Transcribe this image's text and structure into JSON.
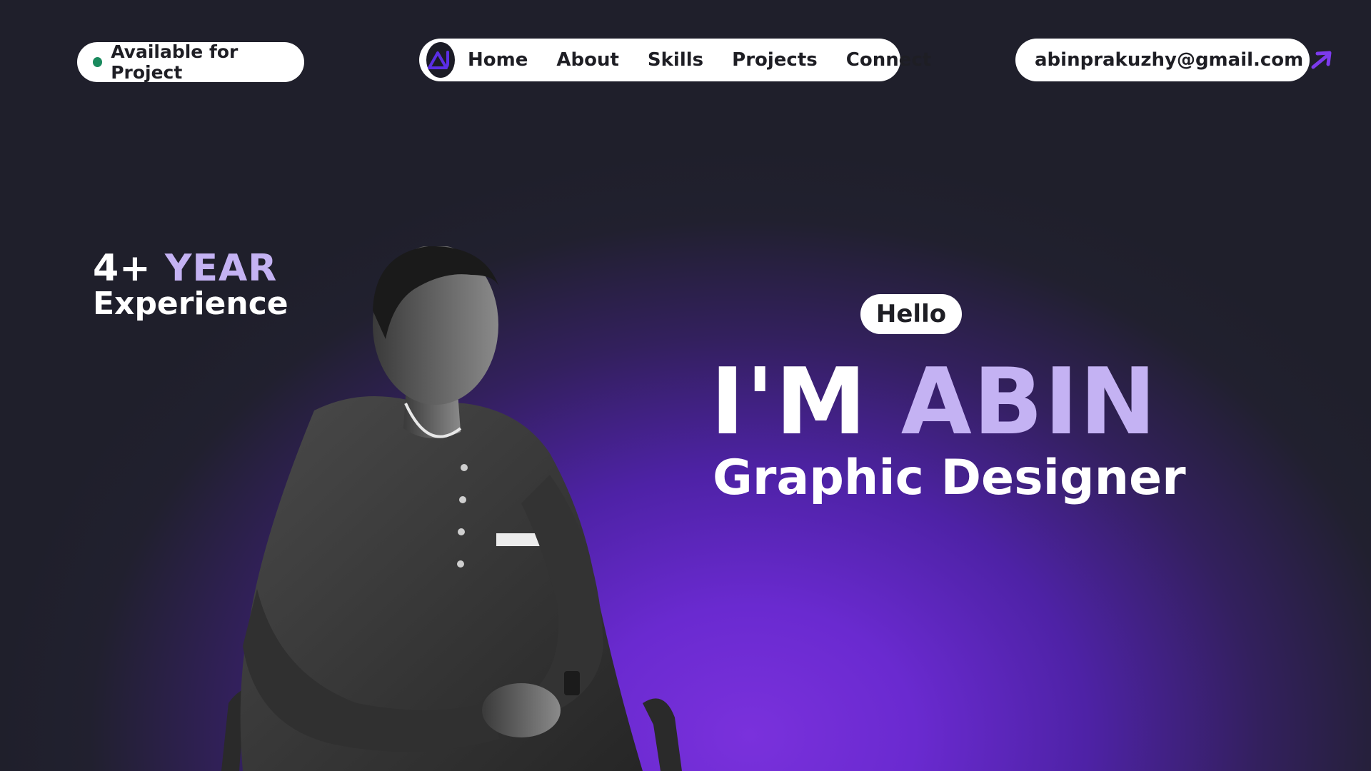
{
  "status": {
    "label": "Available for Project",
    "dot_color": "#1a8a5e"
  },
  "nav": {
    "logo_icon": "logo-icon",
    "items": [
      {
        "label": "Home"
      },
      {
        "label": "About"
      },
      {
        "label": "Skills"
      },
      {
        "label": "Projects"
      },
      {
        "label": "Connect"
      }
    ]
  },
  "contact": {
    "email": "abinprakuzhy@gmail.com",
    "icon": "arrow-up-right-icon",
    "icon_color": "#7c3aed"
  },
  "experience": {
    "years": "4+",
    "unit": "YEAR",
    "label": "Experience"
  },
  "hero": {
    "greeting": "Hello",
    "intro": "I'M",
    "name": "ABIN",
    "role": "Graphic Designer"
  },
  "colors": {
    "accent": "#c4b2f3",
    "background_dark": "#1f1f2b",
    "background_glow": "#7a31dc"
  }
}
